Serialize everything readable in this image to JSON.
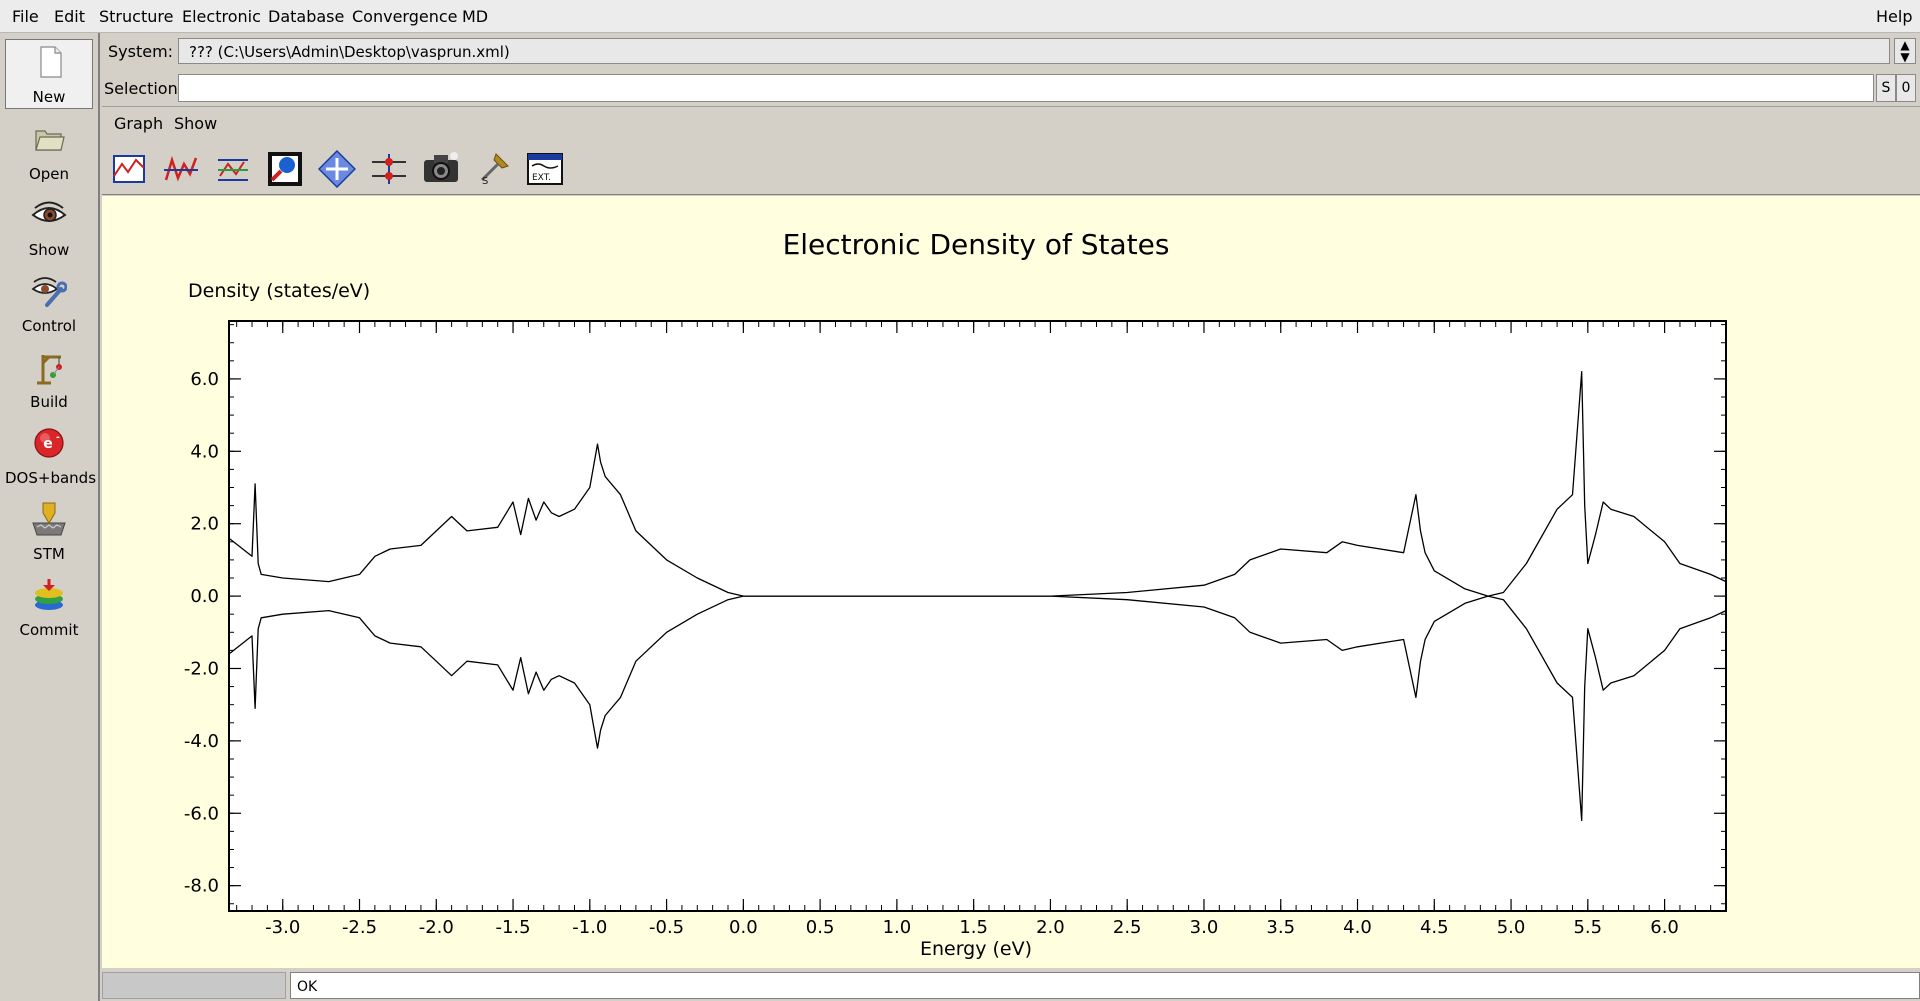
{
  "menu": {
    "file": "File",
    "edit": "Edit",
    "structure": "Structure",
    "electronic": "Electronic",
    "database": "Database",
    "convergence": "Convergence",
    "md": "MD",
    "help": "Help"
  },
  "leftbar": {
    "new": "New",
    "open": "Open",
    "show": "Show",
    "control": "Control",
    "build": "Build",
    "dos": "DOS+bands",
    "stm": "STM",
    "commit": "Commit"
  },
  "system": {
    "label": "System:",
    "value": "??? (C:\\Users\\Admin\\Desktop\\vasprun.xml)"
  },
  "selection": {
    "label": "Selection:",
    "value": "",
    "s_button": "S",
    "zero_button": "0"
  },
  "submenu": {
    "graph": "Graph",
    "show": "Show"
  },
  "toolbar_icons": [
    "plot-icon",
    "curve-icon",
    "fermi-icon",
    "zoom-icon",
    "move-icon",
    "adjust-icon",
    "camera-icon",
    "pin-icon",
    "export-icon"
  ],
  "status": {
    "text": "OK"
  },
  "chart_data": {
    "type": "line",
    "title": "Electronic Density of States",
    "ylabel": "Density (states/eV)",
    "xlabel": "Energy (eV)",
    "xlim": [
      -3.35,
      6.4
    ],
    "ylim": [
      -8.7,
      7.6
    ],
    "x_ticks": [
      "-3.0",
      "-2.5",
      "-2.0",
      "-1.5",
      "-1.0",
      "-0.5",
      "0.0",
      "0.5",
      "1.0",
      "1.5",
      "2.0",
      "2.5",
      "3.0",
      "3.5",
      "4.0",
      "4.5",
      "5.0",
      "5.5",
      "6.0"
    ],
    "x_tick_values": [
      -3.0,
      -2.5,
      -2.0,
      -1.5,
      -1.0,
      -0.5,
      0.0,
      0.5,
      1.0,
      1.5,
      2.0,
      2.5,
      3.0,
      3.5,
      4.0,
      4.5,
      5.0,
      5.5,
      6.0
    ],
    "y_ticks": [
      "6.0",
      "4.0",
      "2.0",
      "0.0",
      "-2.0",
      "-4.0",
      "-6.0",
      "-8.0"
    ],
    "y_tick_values": [
      6.0,
      4.0,
      2.0,
      0.0,
      -2.0,
      -4.0,
      -6.0,
      -8.0
    ],
    "grid": false,
    "series": [
      {
        "x": [
          -3.35,
          -3.2,
          -3.18,
          -3.16,
          -3.14,
          -3.0,
          -2.7,
          -2.5,
          -2.4,
          -2.3,
          -2.1,
          -2.0,
          -1.9,
          -1.8,
          -1.6,
          -1.5,
          -1.45,
          -1.4,
          -1.35,
          -1.3,
          -1.25,
          -1.2,
          -1.1,
          -1.0,
          -0.95,
          -0.93,
          -0.9,
          -0.8,
          -0.7,
          -0.5,
          -0.3,
          -0.1,
          0.0,
          0.5,
          1.0,
          1.5,
          2.0,
          2.5,
          3.0,
          3.2,
          3.3,
          3.5,
          3.8,
          3.9,
          4.0,
          4.3,
          4.38,
          4.41,
          4.44,
          4.5,
          4.7,
          4.85,
          4.95,
          5.1,
          5.3,
          5.4,
          5.46,
          5.48,
          5.5,
          5.55,
          5.6,
          5.65,
          5.8,
          6.0,
          6.1,
          6.3,
          6.4
        ],
        "y": [
          1.6,
          1.1,
          3.1,
          0.9,
          0.6,
          0.5,
          0.4,
          0.6,
          1.1,
          1.3,
          1.4,
          1.8,
          2.2,
          1.8,
          1.9,
          2.6,
          1.7,
          2.7,
          2.1,
          2.6,
          2.3,
          2.2,
          2.4,
          3.0,
          4.2,
          3.7,
          3.3,
          2.8,
          1.8,
          1.0,
          0.5,
          0.1,
          0.0,
          0.0,
          0.0,
          0.0,
          0.0,
          0.1,
          0.3,
          0.6,
          1.0,
          1.3,
          1.2,
          1.5,
          1.4,
          1.2,
          2.8,
          1.8,
          1.2,
          0.7,
          0.2,
          0.0,
          0.1,
          0.9,
          2.4,
          2.8,
          6.2,
          2.5,
          0.9,
          1.7,
          2.6,
          2.4,
          2.2,
          1.5,
          0.9,
          0.6,
          0.4
        ]
      },
      {
        "x": [
          -3.35,
          -3.2,
          -3.18,
          -3.16,
          -3.14,
          -3.0,
          -2.7,
          -2.5,
          -2.4,
          -2.3,
          -2.1,
          -2.0,
          -1.9,
          -1.8,
          -1.6,
          -1.5,
          -1.45,
          -1.4,
          -1.35,
          -1.3,
          -1.25,
          -1.2,
          -1.1,
          -1.0,
          -0.95,
          -0.93,
          -0.9,
          -0.8,
          -0.7,
          -0.5,
          -0.3,
          -0.1,
          0.0,
          0.5,
          1.0,
          1.5,
          2.0,
          2.5,
          3.0,
          3.2,
          3.3,
          3.5,
          3.8,
          3.9,
          4.0,
          4.3,
          4.38,
          4.41,
          4.44,
          4.5,
          4.7,
          4.85,
          4.95,
          5.1,
          5.3,
          5.4,
          5.46,
          5.48,
          5.5,
          5.55,
          5.6,
          5.65,
          5.8,
          6.0,
          6.1,
          6.3,
          6.4
        ],
        "y": [
          -1.6,
          -1.1,
          -3.1,
          -0.9,
          -0.6,
          -0.5,
          -0.4,
          -0.6,
          -1.1,
          -1.3,
          -1.4,
          -1.8,
          -2.2,
          -1.8,
          -1.9,
          -2.6,
          -1.7,
          -2.7,
          -2.1,
          -2.6,
          -2.3,
          -2.2,
          -2.4,
          -3.0,
          -4.2,
          -3.7,
          -3.3,
          -2.8,
          -1.8,
          -1.0,
          -0.5,
          -0.1,
          0.0,
          0.0,
          0.0,
          0.0,
          0.0,
          -0.1,
          -0.3,
          -0.6,
          -1.0,
          -1.3,
          -1.2,
          -1.5,
          -1.4,
          -1.2,
          -2.8,
          -1.8,
          -1.2,
          -0.7,
          -0.2,
          0.0,
          -0.1,
          -0.9,
          -2.4,
          -2.8,
          -6.2,
          -2.5,
          -0.9,
          -1.7,
          -2.6,
          -2.4,
          -2.2,
          -1.5,
          -0.9,
          -0.6,
          -0.4
        ]
      }
    ]
  }
}
